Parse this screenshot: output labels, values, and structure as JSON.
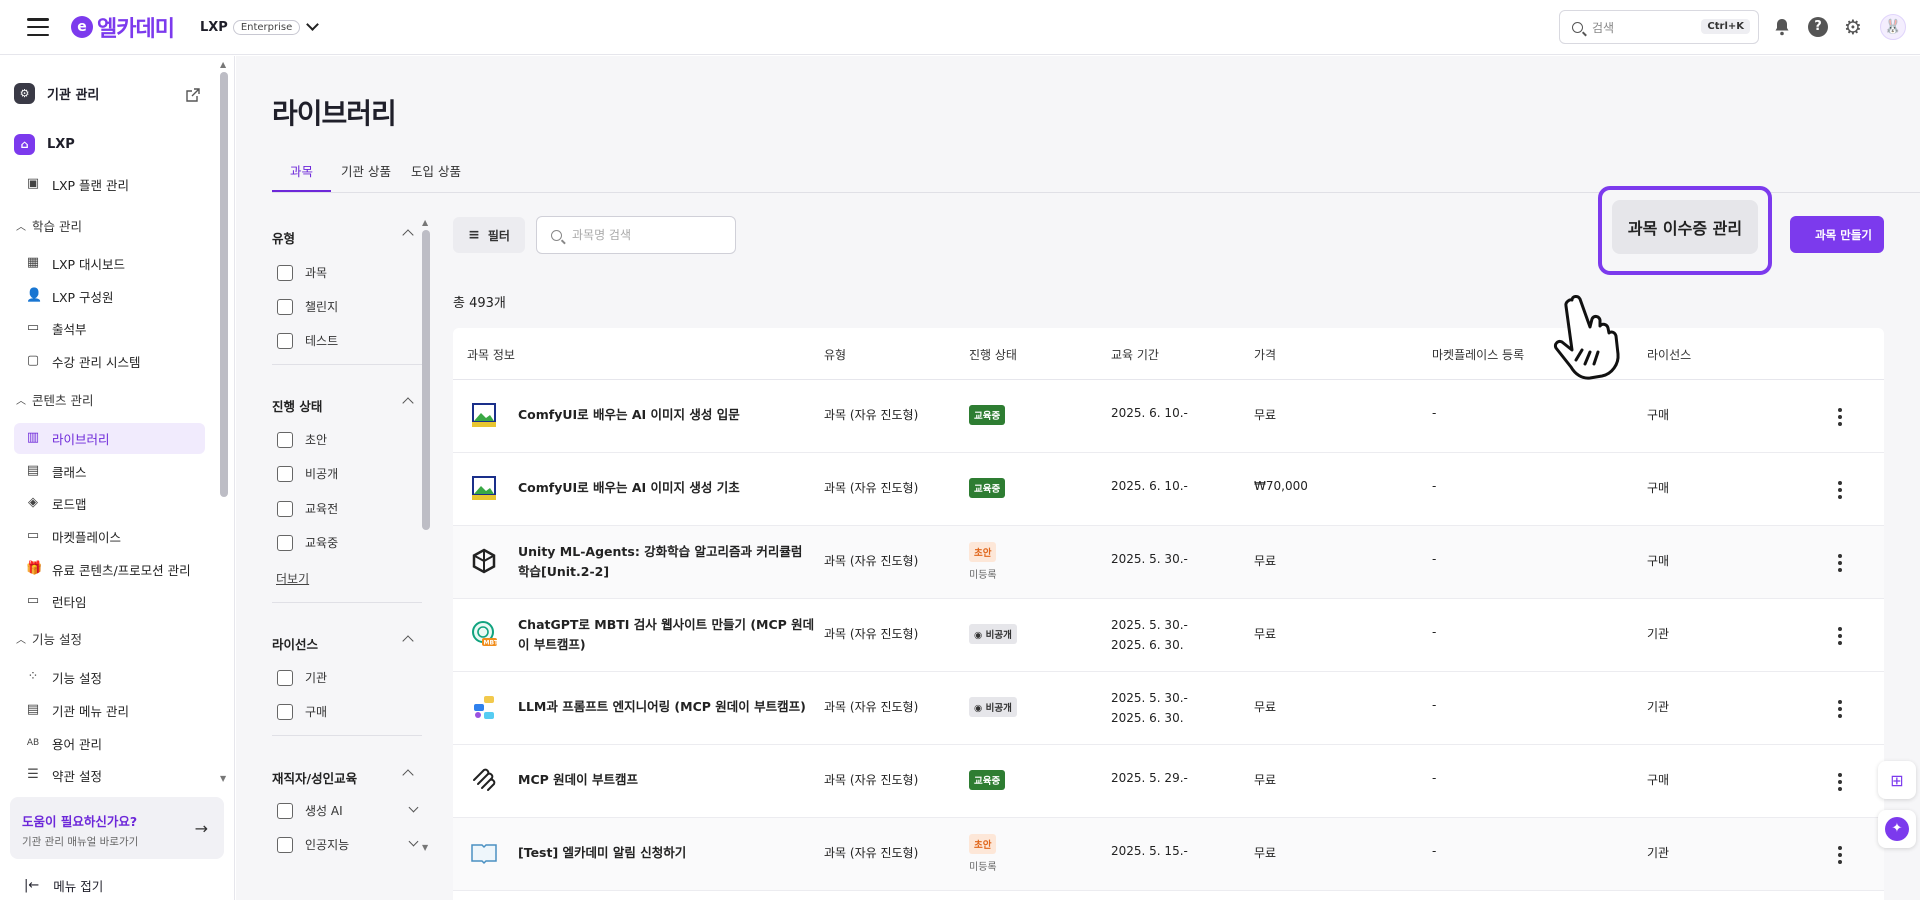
{
  "header": {
    "logo_mark": "e",
    "logo_text": "엘카데미",
    "org_name": "LXP",
    "org_badge": "Enterprise",
    "search_placeholder": "검색",
    "search_shortcut": "Ctrl+K"
  },
  "sidebar": {
    "org_admin": "기관 관리",
    "lxp": "LXP",
    "items_top": [
      {
        "label": "LXP 플랜 관리",
        "icon": "plan-icon"
      }
    ],
    "sections": [
      {
        "title": "학습 관리",
        "items": [
          {
            "label": "LXP 대시보드",
            "icon": "dashboard-icon"
          },
          {
            "label": "LXP 구성원",
            "icon": "members-icon"
          },
          {
            "label": "출석부",
            "icon": "calendar-icon"
          },
          {
            "label": "수강 관리 시스템",
            "icon": "enrollment-icon"
          }
        ]
      },
      {
        "title": "콘텐츠 관리",
        "items": [
          {
            "label": "라이브러리",
            "icon": "library-icon",
            "active": true
          },
          {
            "label": "클래스",
            "icon": "class-icon"
          },
          {
            "label": "로드맵",
            "icon": "roadmap-icon"
          },
          {
            "label": "마켓플레이스",
            "icon": "marketplace-icon"
          },
          {
            "label": "유료 콘텐츠/프로모션 관리",
            "icon": "gift-icon"
          },
          {
            "label": "런타임",
            "icon": "runtime-icon"
          }
        ]
      },
      {
        "title": "기능 설정",
        "items": [
          {
            "label": "기능 설정",
            "icon": "feature-icon"
          },
          {
            "label": "기관 메뉴 관리",
            "icon": "menu-manage-icon"
          },
          {
            "label": "용어 관리",
            "icon": "terms-icon"
          },
          {
            "label": "약관 설정",
            "icon": "policy-icon"
          }
        ]
      }
    ],
    "help_title": "도움이 필요하신가요?",
    "help_sub": "기관 관리 매뉴얼 바로가기",
    "collapse_label": "메뉴 접기"
  },
  "main": {
    "title": "라이브러리",
    "tabs": [
      {
        "label": "과목",
        "active": true
      },
      {
        "label": "기관 상품"
      },
      {
        "label": "도입 상품"
      }
    ],
    "filter_button": "필터",
    "search_placeholder": "과목명 검색",
    "cert_button": "과목 이수증 관리",
    "create_button": "과목 만들기",
    "total": "총 493개"
  },
  "filters": {
    "groups": [
      {
        "title": "유형",
        "options": [
          "과목",
          "챌린지",
          "테스트"
        ]
      },
      {
        "title": "진행 상태",
        "options": [
          "초안",
          "비공개",
          "교육전",
          "교육중"
        ],
        "more": "더보기"
      },
      {
        "title": "라이선스",
        "options": [
          "기관",
          "구매"
        ]
      },
      {
        "title": "재직자/성인교육",
        "options": [
          "생성 AI",
          "인공지능"
        ]
      }
    ]
  },
  "table": {
    "headers": [
      "과목 정보",
      "유형",
      "진행 상태",
      "교육 기간",
      "가격",
      "마켓플레이스 등록",
      "라이선스"
    ],
    "rows": [
      {
        "title": "ComfyUI로 배우는 AI 이미지 생성 입문",
        "type": "과목 (자유 진도형)",
        "status": "교육중",
        "status_color": "green",
        "status_sub": "",
        "period": "2025. 6. 10.-",
        "period2": "",
        "price": "무료",
        "market": "-",
        "license": "구매",
        "thumb": "comfyui-thumb-icon"
      },
      {
        "title": "ComfyUI로 배우는 AI 이미지 생성 기초",
        "type": "과목 (자유 진도형)",
        "status": "교육중",
        "status_color": "green",
        "status_sub": "",
        "period": "2025. 6. 10.-",
        "period2": "",
        "price": "₩70,000",
        "market": "-",
        "license": "구매",
        "thumb": "comfyui-thumb-icon"
      },
      {
        "title": "Unity ML-Agents: 강화학습 알고리즘과 커리큘럼 학습[Unit.2-2]",
        "type": "과목 (자유 진도형)",
        "status": "초안",
        "status_color": "orange",
        "status_sub": "미등록",
        "period": "2025. 5. 30.-",
        "period2": "",
        "price": "무료",
        "market": "-",
        "license": "구매",
        "thumb": "unity-thumb-icon"
      },
      {
        "title": "ChatGPT로 MBTI 검사 웹사이트 만들기 (MCP 원데이 부트캠프)",
        "type": "과목 (자유 진도형)",
        "status": "비공개",
        "status_color": "gray",
        "status_sub": "",
        "period": "2025. 5. 30.-",
        "period2": "2025. 6. 30.",
        "price": "무료",
        "market": "-",
        "license": "기관",
        "thumb": "chatgpt-thumb-icon"
      },
      {
        "title": "LLM과 프롬프트 엔지니어링 (MCP 원데이 부트캠프)",
        "type": "과목 (자유 진도형)",
        "status": "비공개",
        "status_color": "gray",
        "status_sub": "",
        "period": "2025. 5. 30.-",
        "period2": "2025. 6. 30.",
        "price": "무료",
        "market": "-",
        "license": "기관",
        "thumb": "llm-thumb-icon"
      },
      {
        "title": "MCP 원데이 부트캠프",
        "type": "과목 (자유 진도형)",
        "status": "교육중",
        "status_color": "green",
        "status_sub": "",
        "period": "2025. 5. 29.-",
        "period2": "",
        "price": "무료",
        "market": "-",
        "license": "구매",
        "thumb": "mcp-thumb-icon"
      },
      {
        "title": "[Test] 엘카데미 알림 신청하기",
        "type": "과목 (자유 진도형)",
        "status": "초안",
        "status_color": "orange",
        "status_sub": "미등록",
        "period": "2025. 5. 15.-",
        "period2": "",
        "price": "무료",
        "market": "-",
        "license": "기관",
        "thumb": "book-thumb-icon"
      }
    ]
  }
}
